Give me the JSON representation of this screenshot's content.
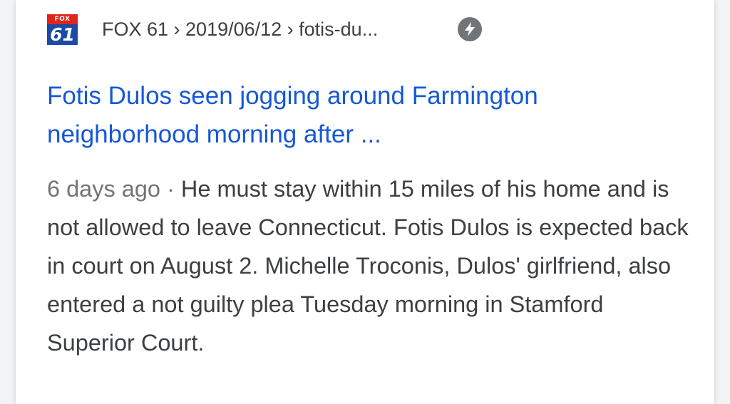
{
  "result": {
    "source": {
      "logo_top": "FOX",
      "logo_bottom": "61",
      "breadcrumb": "FOX 61 › 2019/06/12 › fotis-du...",
      "amp_icon": "lightning-bolt-icon"
    },
    "title": "Fotis Dulos seen jogging around Farmington neighborhood morning after ...",
    "date": "6 days ago",
    "separator": " · ",
    "snippet": "He must stay within 15 miles of his home and is not allowed to leave Connecticut. Fotis Dulos is expected back in court on August 2. Michelle Troconis, Dulos' girlfriend, also entered a not guilty plea Tuesday morning in Stamford Superior Court."
  },
  "colors": {
    "title": "#1558d6",
    "text": "#3c4043",
    "meta": "#70757a",
    "logo_red": "#e2231a",
    "logo_blue": "#1b4aa6"
  }
}
